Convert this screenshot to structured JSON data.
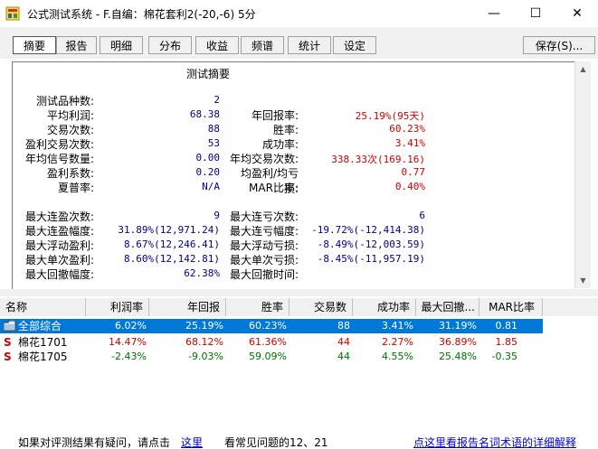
{
  "window": {
    "title": "公式测试系统 - F.自编：棉花套利2(-20,-6) 5分",
    "minimize": "—",
    "maximize": "☐",
    "close": "✕"
  },
  "tabs": [
    "摘要",
    "报告",
    "明细",
    "分布",
    "收益",
    "频谱",
    "统计",
    "设定"
  ],
  "save_button": "保存(S)...",
  "summary": {
    "title": "测试摘要",
    "left": [
      {
        "label": "测试品种数:",
        "value": "2",
        "color": "#00008b"
      },
      {
        "label": "平均利润:",
        "value": "68.38",
        "color": "#00008b"
      },
      {
        "label": "交易次数:",
        "value": "88",
        "color": "#00008b"
      },
      {
        "label": "盈利交易次数:",
        "value": "53",
        "color": "#00008b"
      },
      {
        "label": "年均信号数量:",
        "value": "0.00",
        "color": "#00008b"
      },
      {
        "label": "盈利系数:",
        "value": "0.20",
        "color": "#00008b"
      },
      {
        "label": "夏普率:",
        "value": "N/A",
        "color": "#00008b"
      }
    ],
    "right": [
      {
        "label": "",
        "value": "",
        "color": "#d00000"
      },
      {
        "label": "年回报率:",
        "value": "25.19%(95天)",
        "color": "#d00000"
      },
      {
        "label": "胜率:",
        "value": "60.23%",
        "color": "#d00000"
      },
      {
        "label": "成功率:",
        "value": "3.41%",
        "color": "#d00000"
      },
      {
        "label": "年均交易次数:",
        "value": "338.33次(169.16)",
        "color": "#d00000"
      },
      {
        "label": "均盈利/均亏损:",
        "value": "0.77",
        "color": "#d00000"
      },
      {
        "label": "MAR比率:",
        "value": "0.40%",
        "color": "#d00000"
      }
    ],
    "left2": [
      {
        "label": "最大连盈次数:",
        "value": "9"
      },
      {
        "label": "最大连盈幅度:",
        "value": "31.89%(12,971.24)"
      },
      {
        "label": "最大浮动盈利:",
        "value": "8.67%(12,246.41)"
      },
      {
        "label": "最大单次盈利:",
        "value": "8.60%(12,142.81)"
      },
      {
        "label": "最大回撤幅度:",
        "value": "62.38%"
      }
    ],
    "right2": [
      {
        "label": "最大连亏次数:",
        "value": "6"
      },
      {
        "label": "最大连亏幅度:",
        "value": "-19.72%(-12,414.38)"
      },
      {
        "label": "最大浮动亏损:",
        "value": "-8.49%(-12,003.59)"
      },
      {
        "label": "最大单次亏损:",
        "value": "-8.45%(-11,957.19)"
      },
      {
        "label": "最大回撤时间:",
        "value": ""
      }
    ]
  },
  "grid": {
    "headers": [
      "名称",
      "利润率",
      "年回报",
      "胜率",
      "交易数",
      "成功率",
      "最大回撤...",
      "MAR比率"
    ],
    "rows": [
      {
        "icon": "folder-icon",
        "name": "全部综合",
        "values": [
          "6.02%",
          "25.19%",
          "60.23%",
          "88",
          "3.41%",
          "31.19%",
          "0.81"
        ]
      },
      {
        "icon": "S",
        "name": "棉花1701",
        "values": [
          "14.47%",
          "68.12%",
          "61.36%",
          "44",
          "2.27%",
          "36.89%",
          "1.85"
        ]
      },
      {
        "icon": "S",
        "name": "棉花1705",
        "values": [
          "-2.43%",
          "-9.03%",
          "59.09%",
          "44",
          "4.55%",
          "25.48%",
          "-0.35"
        ]
      }
    ]
  },
  "status": {
    "question_text": "如果对评测结果有疑问，请点击",
    "here_link": "这里",
    "faq_text": "看常见问题的12、21",
    "right_link": "点这里看报告名词术语的详细解释"
  },
  "colors": {
    "selected_row": "#0078d7",
    "negative": "#007000",
    "positive": "#d00000"
  }
}
